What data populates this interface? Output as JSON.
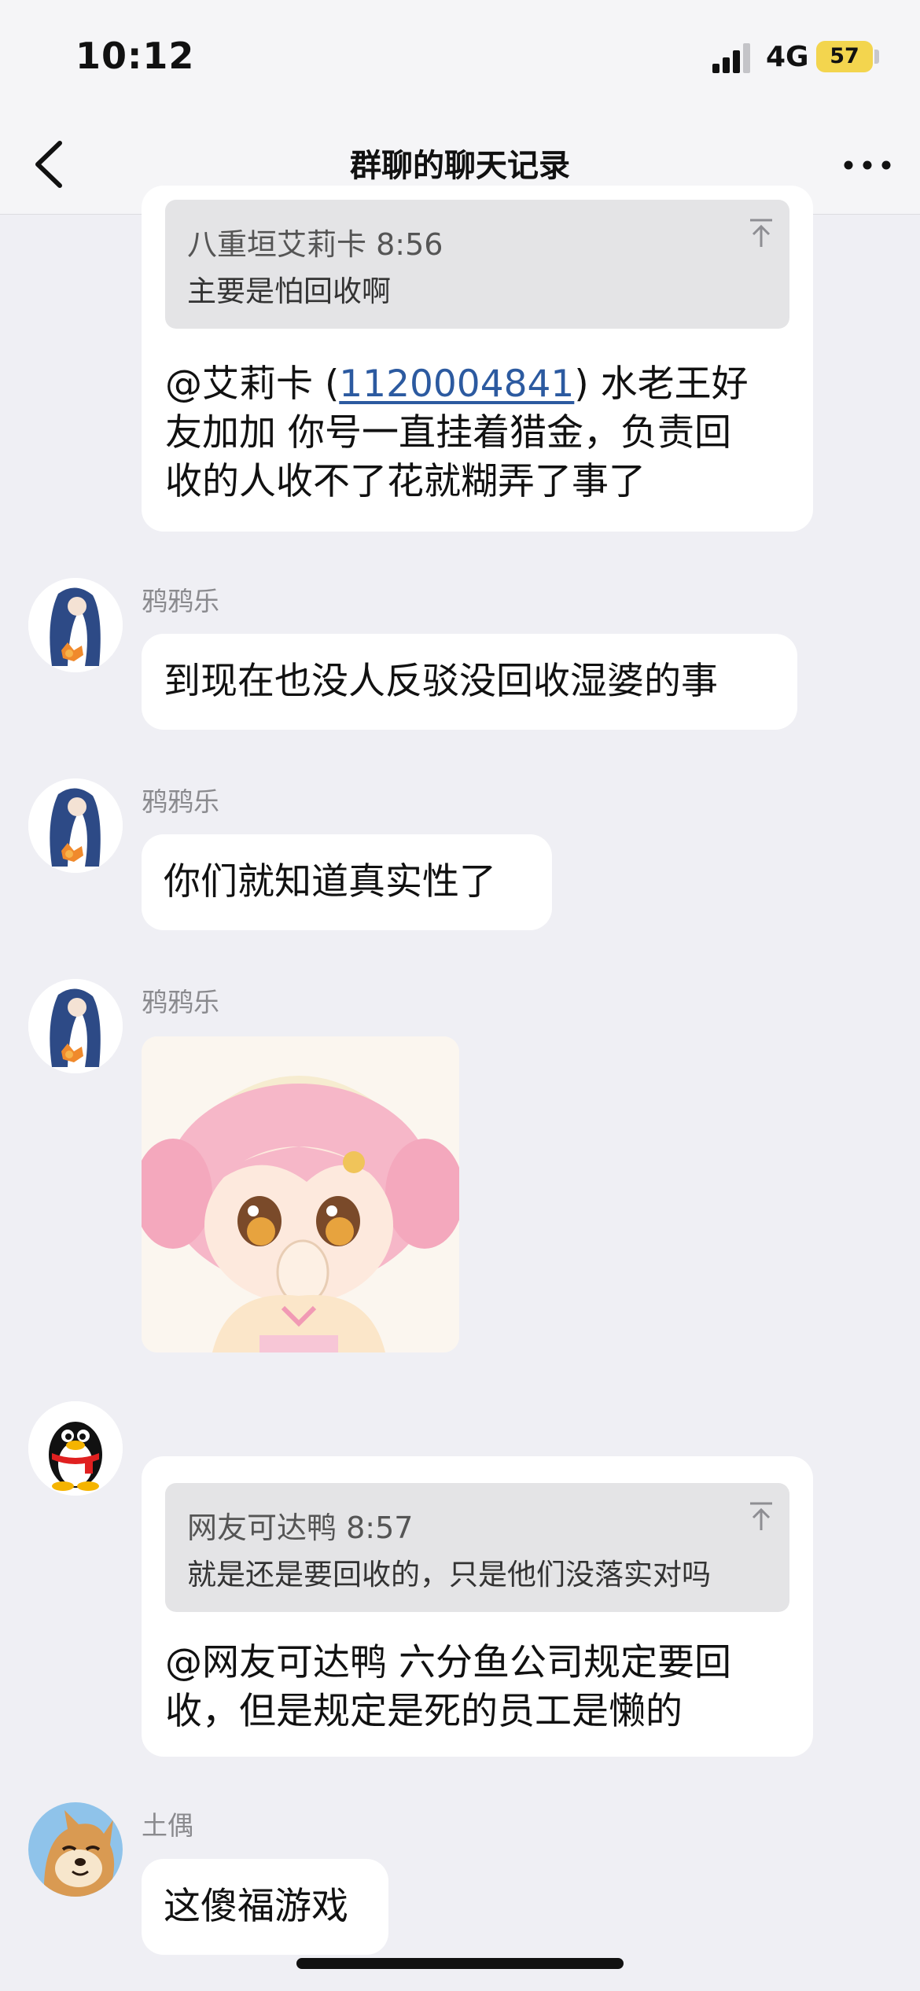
{
  "status_bar": {
    "time": "10:12",
    "network": "4G",
    "battery": "57"
  },
  "nav": {
    "title": "群聊的聊天记录",
    "back_icon": "chevron-left-icon",
    "more_icon": "ellipsis-icon"
  },
  "messages": [
    {
      "quote": {
        "author": "八重垣艾莉卡",
        "time": "8:56",
        "text": "主要是怕回收啊"
      },
      "line1_a": "@艾莉卡 (",
      "line1_link": "1120004841",
      "line1_b": ") 水老王好",
      "line2": "友加加 你号一直挂着猎金，负责回",
      "line3": "收的人收不了花就糊弄了事了"
    },
    {
      "sender": "鸦鸦乐",
      "text": "到现在也没人反驳没回收湿婆的事"
    },
    {
      "sender": "鸦鸦乐",
      "text": "你们就知道真实性了"
    },
    {
      "sender": "鸦鸦乐",
      "image": "anime-sticker"
    },
    {
      "quote": {
        "author": "网友可达鸭",
        "time": "8:57",
        "text": "就是还是要回收的，只是他们没落实对吗"
      },
      "line1": "@网友可达鸭 六分鱼公司规定要回",
      "line2": "收，但是规定是死的员工是懒的"
    },
    {
      "sender": "土偶",
      "text": "这傻福游戏"
    }
  ],
  "colors": {
    "background": "#efeff4",
    "bubble": "#ffffff",
    "quote": "#e4e4e6",
    "link": "#2c5aa0",
    "battery": "#f3d54e"
  }
}
